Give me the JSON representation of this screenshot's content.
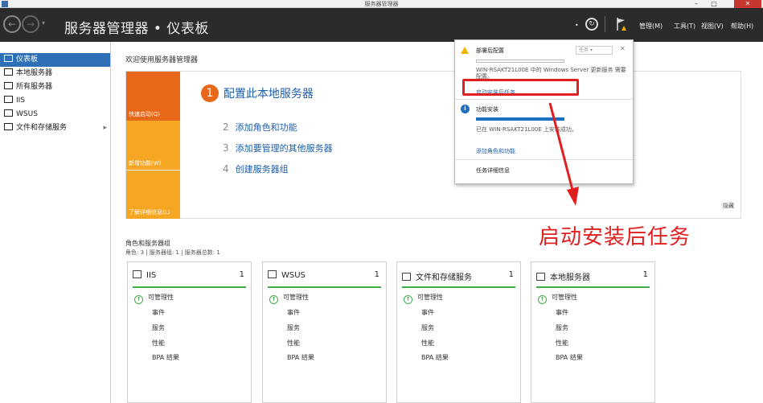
{
  "window": {
    "title": "服务器管理器",
    "minimize": "–",
    "maximize": "□",
    "close": "✕"
  },
  "header": {
    "breadcrumb": "服务器管理器 • 仪表板",
    "menu": [
      "管理(M)",
      "工具(T)",
      "视图(V)",
      "帮助(H)"
    ],
    "dropdown": "•"
  },
  "sidebar": {
    "items": [
      {
        "label": "仪表板",
        "icon": "dashboard-icon",
        "active": true
      },
      {
        "label": "本地服务器",
        "icon": "server-icon"
      },
      {
        "label": "所有服务器",
        "icon": "servers-icon"
      },
      {
        "label": "IIS",
        "icon": "iis-icon"
      },
      {
        "label": "WSUS",
        "icon": "wsus-icon"
      },
      {
        "label": "文件和存储服务",
        "icon": "storage-icon",
        "chevron": "▸"
      }
    ]
  },
  "main": {
    "welcome": "欢迎使用服务器管理器",
    "tiles": [
      "快速启动(Q)",
      "新增功能(W)",
      "了解详细信息(L)"
    ],
    "step1": {
      "num": "1",
      "label": "配置此本地服务器"
    },
    "steps": [
      {
        "num": "2",
        "label": "添加角色和功能"
      },
      {
        "num": "3",
        "label": "添加要管理的其他服务器"
      },
      {
        "num": "4",
        "label": "创建服务器组"
      }
    ],
    "hide": "隐藏",
    "roles_title": "角色和服务器组",
    "roles_sub": "角色: 3 | 服务器组: 1 | 服务器总数: 1",
    "cards": [
      {
        "title": "IIS",
        "count": "1",
        "icon": "iis-icon"
      },
      {
        "title": "WSUS",
        "count": "1",
        "icon": "wsus-icon"
      },
      {
        "title": "文件和存储服务",
        "count": "1",
        "icon": "storage-icon"
      },
      {
        "title": "本地服务器",
        "count": "1",
        "icon": "server-icon"
      }
    ],
    "card_rows": [
      "可管理性",
      "事件",
      "服务",
      "性能",
      "BPA 结果"
    ]
  },
  "popup": {
    "sec1_title": "部署后配置",
    "task_btn": "任务 ▾",
    "close": "✕",
    "desc1": "WIN-RSAKT21L00E 中的 Windows Server 更新服务 需要配置。",
    "task_link": "启动安装后任务",
    "sec2_title": "功能安装",
    "desc2": "已在 WIN-RSAKT21L00E 上安装成功。",
    "add_link": "添加角色和功能",
    "detail_link": "任务详细信息"
  },
  "annotation": {
    "text": "启动安装后任务",
    "color": "#e02020"
  },
  "colors": {
    "accent": "#2f6fb5",
    "header": "#2b2b2b",
    "orange": "#e8681a",
    "amber": "#f5a623",
    "ok": "#3fae49"
  }
}
